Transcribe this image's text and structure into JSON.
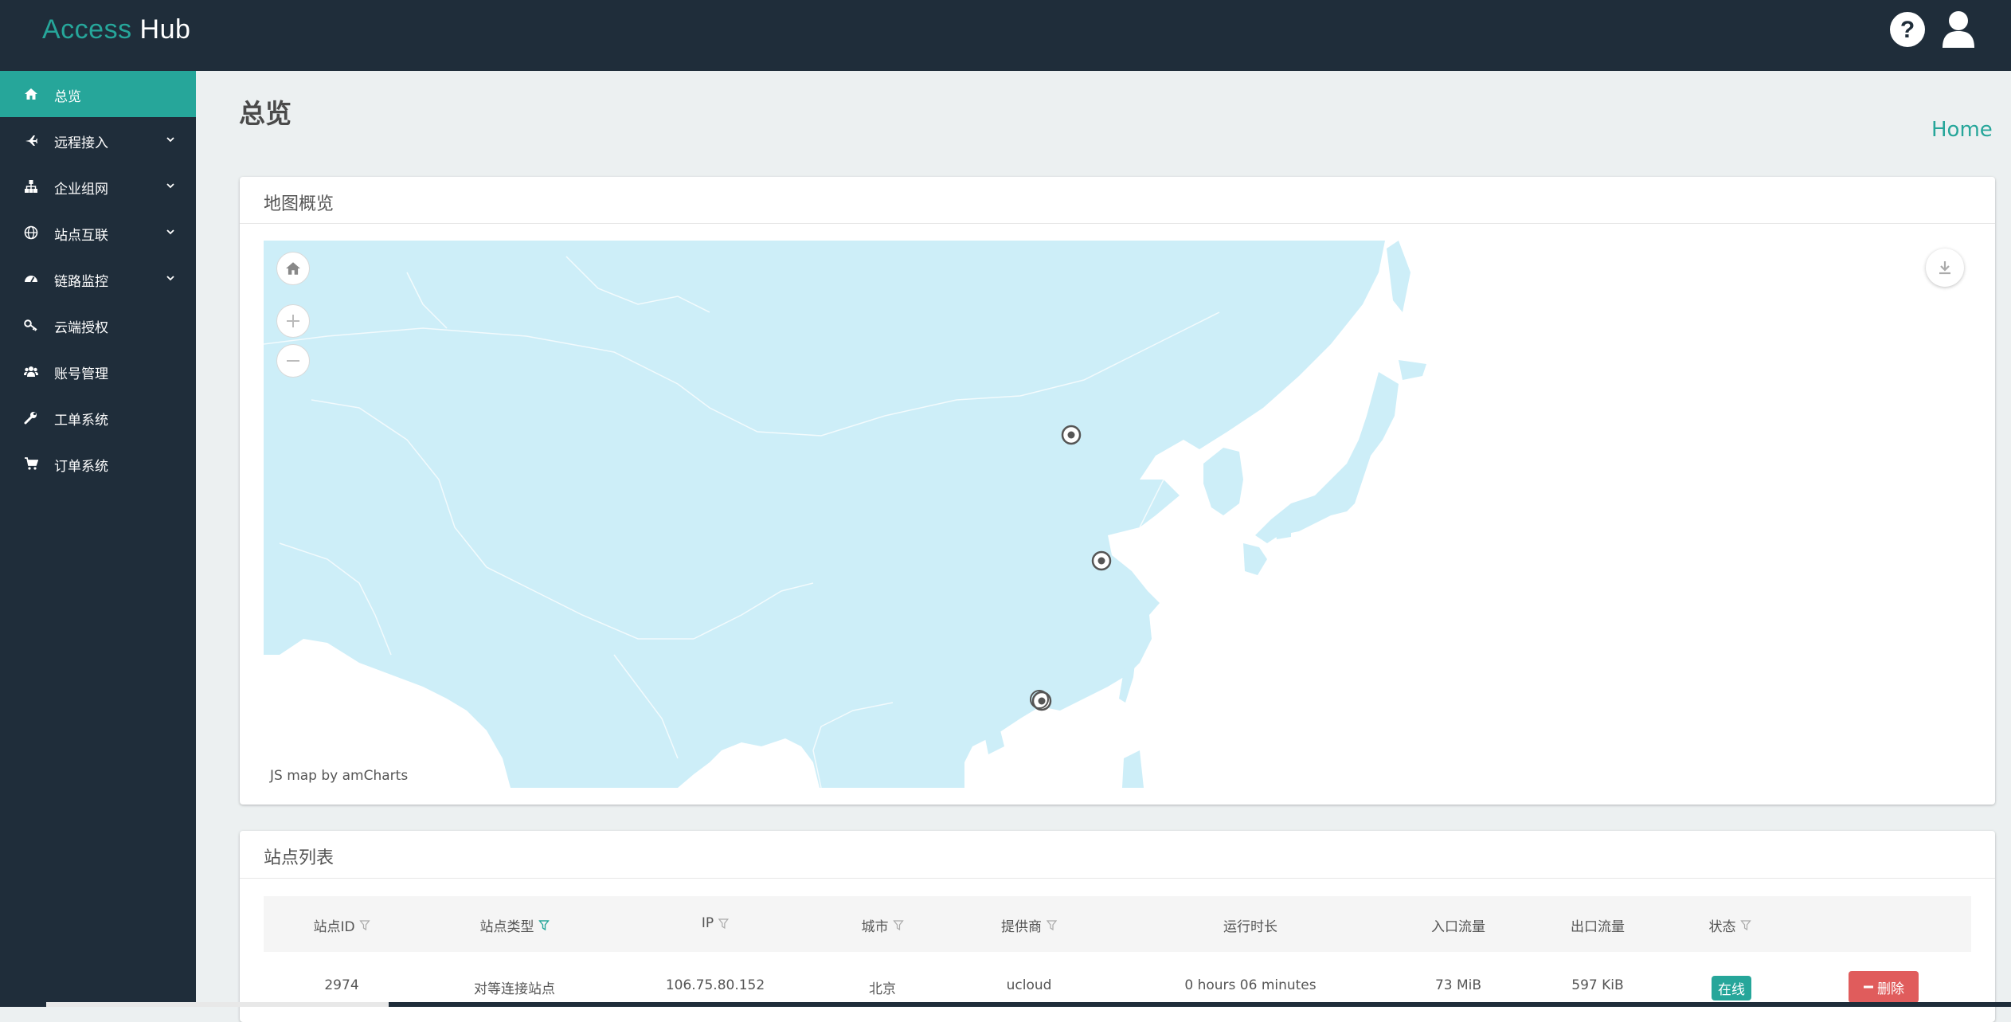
{
  "app": {
    "brand_part1": "Access",
    "brand_part2": "Hub"
  },
  "colors": {
    "accent": "#26a69a",
    "navbar": "#1f2d3a",
    "danger": "#e05c5c",
    "map_land": "#cdeef8"
  },
  "sidebar": {
    "items": [
      {
        "label": "总览",
        "icon": "home-icon",
        "active": true
      },
      {
        "label": "远程接入",
        "icon": "plane-icon",
        "has_children": true
      },
      {
        "label": "企业组网",
        "icon": "sitemap-icon",
        "has_children": true
      },
      {
        "label": "站点互联",
        "icon": "globe-icon",
        "has_children": true
      },
      {
        "label": "链路监控",
        "icon": "dashboard-icon",
        "has_children": true
      },
      {
        "label": "云端授权",
        "icon": "key-icon"
      },
      {
        "label": "账号管理",
        "icon": "users-icon"
      },
      {
        "label": "工单系统",
        "icon": "wrench-icon"
      },
      {
        "label": "订单系统",
        "icon": "cart-icon"
      }
    ]
  },
  "page": {
    "title": "总览",
    "breadcrumb": "Home"
  },
  "map": {
    "title": "地图概览",
    "credit": "JS map by amCharts"
  },
  "table": {
    "title": "站点列表",
    "columns": [
      "站点ID",
      "站点类型",
      "IP",
      "城市",
      "提供商",
      "运行时长",
      "入口流量",
      "出口流量",
      "状态"
    ],
    "rows": [
      {
        "id": "2974",
        "type": "对等连接站点",
        "ip": "106.75.80.152",
        "city": "北京",
        "provider": "ucloud",
        "uptime": "0 hours 06 minutes",
        "in_traffic": "73 MiB",
        "out_traffic": "597 KiB",
        "status": "在线",
        "action": "删除"
      }
    ]
  }
}
